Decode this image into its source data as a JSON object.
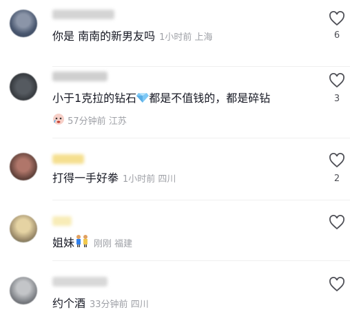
{
  "comments": [
    {
      "text": "你是 南南的新男友吗",
      "meta": "1小时前 上海",
      "likes": "6",
      "avatar_color": "#5b6b84"
    },
    {
      "text_before": "小于1克拉的钻石",
      "emoji": "gem-emoji",
      "text_after": "都是不值钱的，都是碎钻",
      "meta": "57分钟前 江苏",
      "likes": "3",
      "avatar_color": "#3e4147"
    },
    {
      "text": "打得一手好拳",
      "meta": "1小时前 四川",
      "likes": "2",
      "avatar_color": "#7a5a52"
    },
    {
      "text": "姐妹",
      "emoji": "sisters-emoji",
      "meta": "刚刚 福建",
      "likes": "",
      "avatar_color": "#c9b58a"
    },
    {
      "text": "约个酒",
      "meta": "33分钟前 四川",
      "likes": "",
      "avatar_color": "#8c8f94"
    }
  ],
  "colors": {
    "text": "#161823",
    "meta": "#9ea0a6",
    "divider": "#efefef"
  }
}
